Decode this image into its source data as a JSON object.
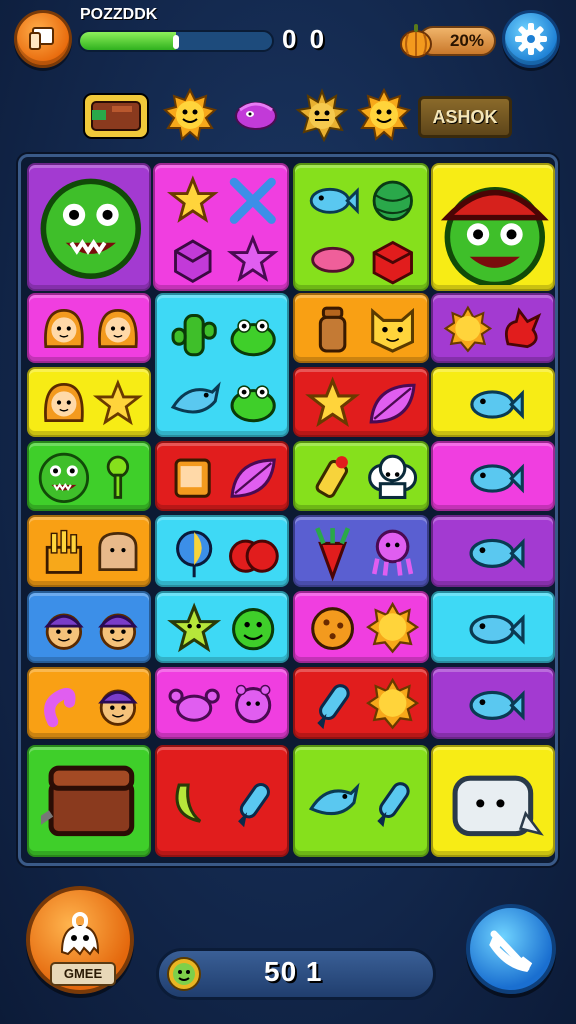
{
  "hud": {
    "player_name": "POZZDDK",
    "progress": 0.5,
    "score": "0 0",
    "percent": "20%"
  },
  "strip": {
    "items": [
      "chest-icon",
      "sun-icon",
      "purple-blob-icon",
      "spiky-creature-icon",
      "sun-icon"
    ],
    "label": "ASHOK"
  },
  "colors": {
    "purple": "#a33ad1",
    "magenta": "#f03ee0",
    "lime": "#86e01c",
    "yellow": "#f7ec15",
    "cyan": "#3ed9f5",
    "orange": "#f9a014",
    "red": "#e11d1d",
    "blue": "#3c8fe8",
    "green": "#3fcf2a",
    "indigo": "#5a5fd1"
  },
  "board": {
    "tiles": [
      {
        "color": "purple",
        "icons": [
          "monster-face-icon"
        ]
      },
      {
        "color": "magenta",
        "icons": [
          "star-icon",
          "cross-sticks-icon",
          "cube-icon",
          "star-outline-icon"
        ]
      },
      {
        "color": "lime",
        "icons": [
          "fish-icon",
          "ball-icon",
          "bean-icon",
          "red-box-icon"
        ]
      },
      {
        "color": "yellow",
        "icons": [
          "pirate-monster-icon"
        ]
      },
      {
        "color": "magenta",
        "icons": [
          "girl-face-icon",
          "girl-face-icon"
        ]
      },
      {
        "color": "cyan",
        "icons": [
          "cactus-icon",
          "frog-icon",
          "bird-icon",
          "frog-icon"
        ]
      },
      {
        "color": "orange",
        "icons": [
          "bottle-icon",
          "cat-face-icon"
        ]
      },
      {
        "color": "purple",
        "icons": [
          "sun-icon",
          "hand-icon"
        ]
      },
      {
        "color": "yellow",
        "icons": [
          "girl-face-icon",
          "star-icon"
        ]
      },
      {
        "color": "red",
        "icons": [
          "star-icon",
          "leaf-icon"
        ]
      },
      {
        "color": "yellow",
        "icons": [
          "fish-icon"
        ]
      },
      {
        "color": "green",
        "icons": [
          "monster-face-icon",
          "key-icon"
        ]
      },
      {
        "color": "red",
        "icons": [
          "jar-icon",
          "leaf-icon"
        ]
      },
      {
        "color": "lime",
        "icons": [
          "drink-icon",
          "cloud-face-icon"
        ]
      },
      {
        "color": "magenta",
        "icons": [
          "fish-icon"
        ]
      },
      {
        "color": "orange",
        "icons": [
          "fries-icon",
          "bread-icon"
        ]
      },
      {
        "color": "cyan",
        "icons": [
          "balloon-icon",
          "apple-icon"
        ]
      },
      {
        "color": "indigo",
        "icons": [
          "carrot-icon",
          "octopus-icon"
        ]
      },
      {
        "color": "purple",
        "icons": [
          "fish-icon"
        ]
      },
      {
        "color": "blue",
        "icons": [
          "boy-face-icon",
          "boy-face-icon"
        ]
      },
      {
        "color": "cyan",
        "icons": [
          "star-face-icon",
          "smiley-icon"
        ]
      },
      {
        "color": "magenta",
        "icons": [
          "cookie-icon",
          "sun-icon"
        ]
      },
      {
        "color": "cyan",
        "icons": [
          "fish-icon"
        ]
      },
      {
        "color": "orange",
        "icons": [
          "worm-icon",
          "boy-face-icon"
        ]
      },
      {
        "color": "magenta",
        "icons": [
          "crab-icon",
          "bug-icon"
        ]
      },
      {
        "color": "red",
        "icons": [
          "rocket-icon",
          "sun-icon"
        ]
      },
      {
        "color": "purple",
        "icons": [
          "fish-icon"
        ]
      },
      {
        "color": "green",
        "icons": [
          "treasure-chest-icon"
        ]
      },
      {
        "color": "red",
        "icons": [
          "banana-icon",
          "rocket-icon"
        ]
      },
      {
        "color": "lime",
        "icons": [
          "bird-icon",
          "rocket-icon"
        ]
      },
      {
        "color": "yellow",
        "icons": [
          "toaster-icon"
        ]
      }
    ]
  },
  "bottom": {
    "game_label": "GMEE",
    "score": "50 1"
  }
}
